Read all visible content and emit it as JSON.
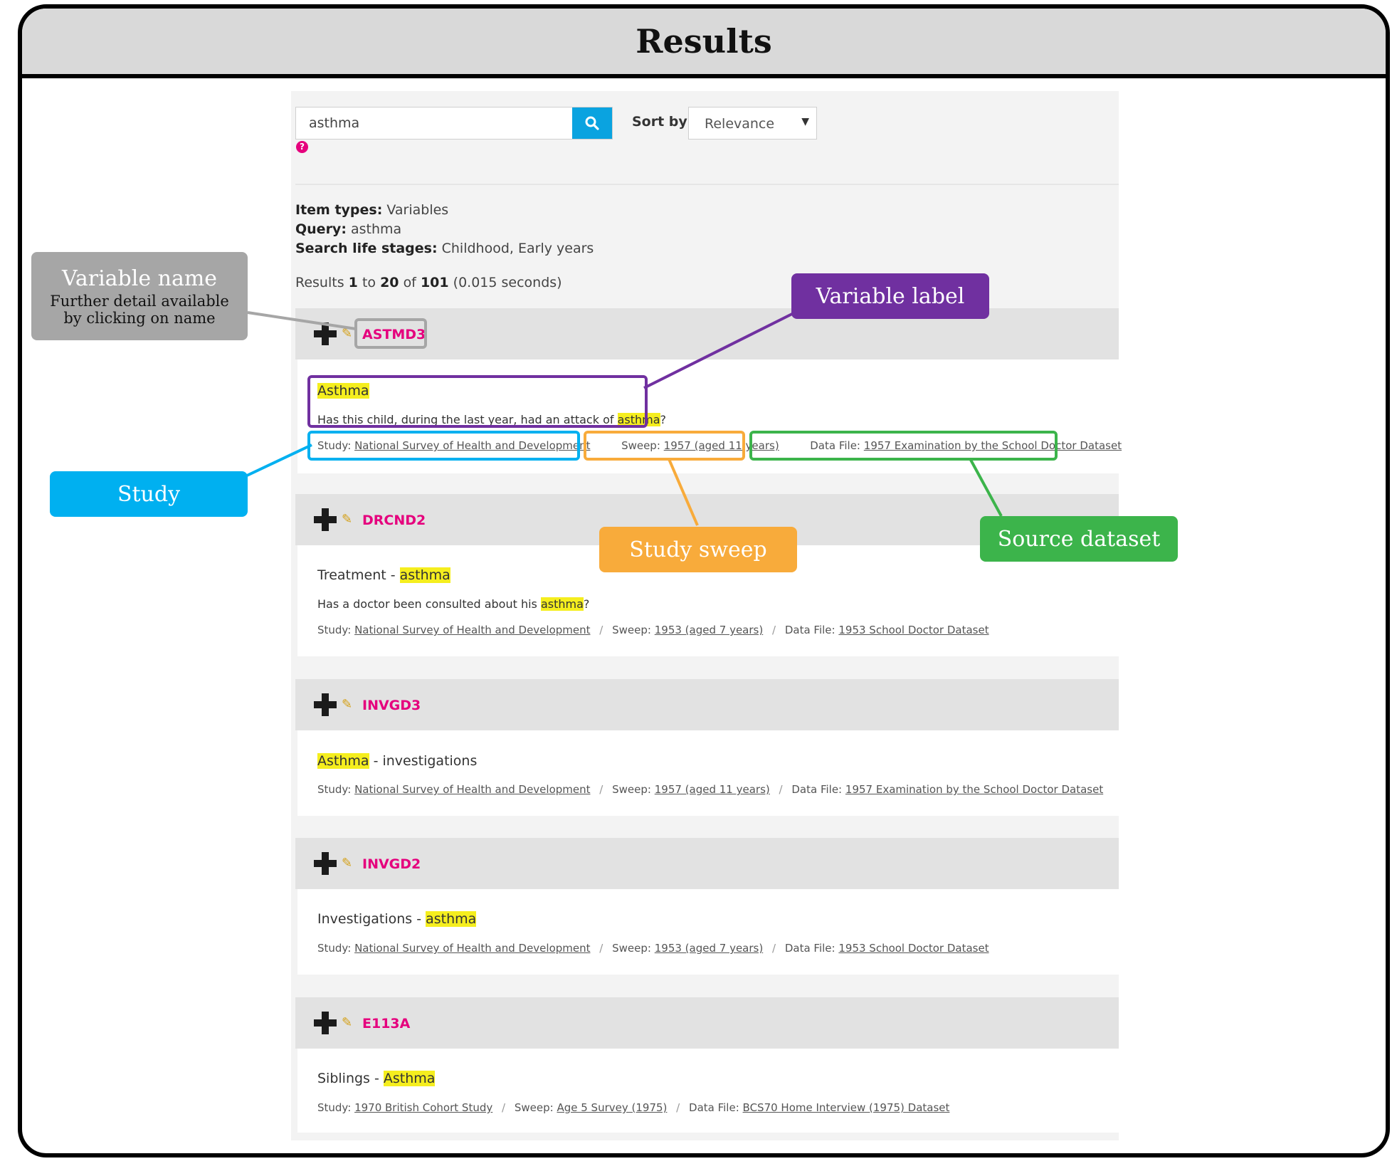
{
  "frame": {
    "title": "Results"
  },
  "search": {
    "value": "asthma",
    "sort_label": "Sort by:",
    "sort_value": "Relevance",
    "help": "?"
  },
  "meta": {
    "item_types_label": "Item types:",
    "item_types_value": "Variables",
    "query_label": "Query:",
    "query_value": "asthma",
    "life_stages_label": "Search life stages:",
    "life_stages_value": "Childhood, Early years",
    "results_prefix": "Results",
    "results_from": "1",
    "results_to_word": "to",
    "results_to": "20",
    "results_of_word": "of",
    "results_total": "101",
    "results_time": "(0.015 seconds)"
  },
  "results": [
    {
      "name": "ASTMD3",
      "label_parts": [
        {
          "text": "Asthma",
          "hl": true
        }
      ],
      "question_parts": [
        {
          "text": "Has this child, during the last year, had an attack of ",
          "hl": false
        },
        {
          "text": "asthma",
          "hl": true
        },
        {
          "text": "?",
          "hl": false
        }
      ],
      "study": "National Survey of Health and Development",
      "sweep": "1957 (aged 11 years)",
      "datafile": "1957 Examination by the School Doctor Dataset"
    },
    {
      "name": "DRCND2",
      "label_parts": [
        {
          "text": "Treatment - ",
          "hl": false
        },
        {
          "text": "asthma",
          "hl": true
        }
      ],
      "question_parts": [
        {
          "text": "Has a doctor been consulted about his ",
          "hl": false
        },
        {
          "text": "asthma",
          "hl": true
        },
        {
          "text": "?",
          "hl": false
        }
      ],
      "study": "National Survey of Health and Development",
      "sweep": "1953 (aged 7 years)",
      "datafile": "1953 School Doctor Dataset"
    },
    {
      "name": "INVGD3",
      "label_parts": [
        {
          "text": "Asthma",
          "hl": true
        },
        {
          "text": " - investigations",
          "hl": false
        }
      ],
      "question_parts": [],
      "study": "National Survey of Health and Development",
      "sweep": "1957 (aged 11 years)",
      "datafile": "1957 Examination by the School Doctor Dataset"
    },
    {
      "name": "INVGD2",
      "label_parts": [
        {
          "text": "Investigations - ",
          "hl": false
        },
        {
          "text": "asthma",
          "hl": true
        }
      ],
      "question_parts": [],
      "study": "National Survey of Health and Development",
      "sweep": "1953 (aged 7 years)",
      "datafile": "1953 School Doctor Dataset"
    },
    {
      "name": "E113A",
      "label_parts": [
        {
          "text": "Siblings - ",
          "hl": false
        },
        {
          "text": "Asthma",
          "hl": true
        }
      ],
      "question_parts": [],
      "study": "1970 British Cohort Study",
      "sweep": "Age 5 Survey (1975)",
      "datafile": "BCS70 Home Interview (1975) Dataset"
    }
  ],
  "field_labels": {
    "study": "Study:",
    "sweep": "Sweep:",
    "datafile": "Data File:",
    "separator": "/"
  },
  "callouts": {
    "variable_name_title": "Variable name",
    "variable_name_line1": "Further detail available",
    "variable_name_line2": "by clicking on name",
    "variable_label": "Variable label",
    "study": "Study",
    "study_sweep": "Study sweep",
    "source_dataset": "Source dataset"
  },
  "colors": {
    "variable_name": "#a6a6a6",
    "variable_label": "#7030a0",
    "study": "#00b0f0",
    "study_sweep": "#f8ab3b",
    "source_dataset": "#3cb44b",
    "var_link": "#e5007d",
    "highlight": "#f5ee1e"
  }
}
